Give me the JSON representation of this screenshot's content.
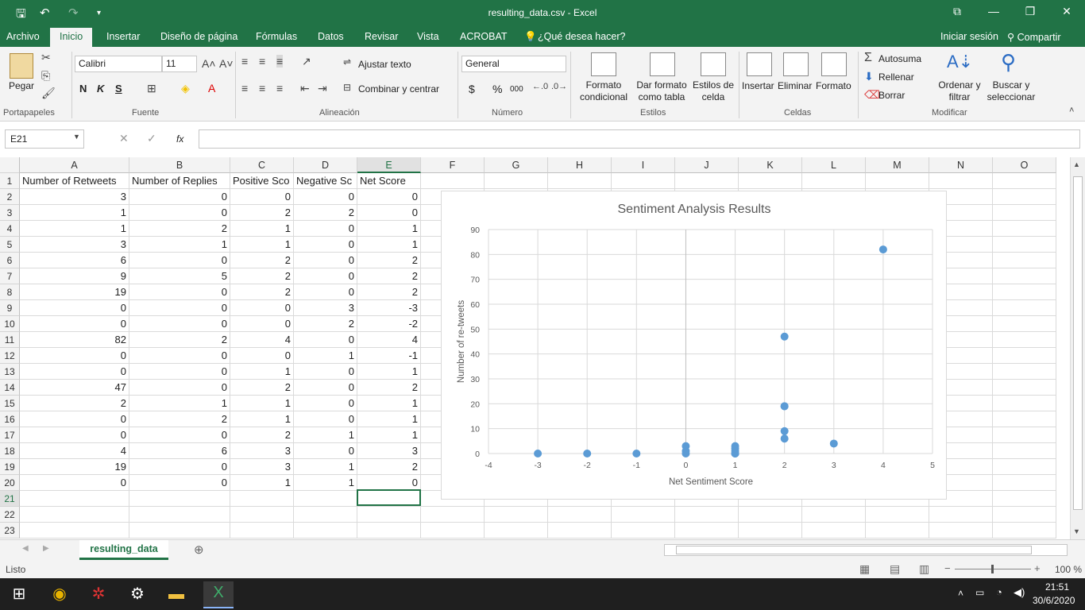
{
  "window": {
    "title": "resulting_data.csv - Excel"
  },
  "tabs": [
    "Archivo",
    "Inicio",
    "Insertar",
    "Diseño de página",
    "Fórmulas",
    "Datos",
    "Revisar",
    "Vista",
    "ACROBAT"
  ],
  "tell_me": "¿Qué desea hacer?",
  "signin": "Iniciar sesión",
  "share": "Compartir",
  "ribbon": {
    "paste": "Pegar",
    "font_name": "Calibri",
    "font_size": "11",
    "bold": "N",
    "italic": "K",
    "underline": "S",
    "wrap_text": "Ajustar texto",
    "merge_center": "Combinar y centrar",
    "number_format": "General",
    "currency": "$",
    "percent": "%",
    "thousands": "000",
    "cond_format_1": "Formato",
    "cond_format_2": "condicional",
    "table_format_1": "Dar formato",
    "table_format_2": "como tabla",
    "cell_styles_1": "Estilos de",
    "cell_styles_2": "celda",
    "insert": "Insertar",
    "delete": "Eliminar",
    "format": "Formato",
    "autosum": "Autosuma",
    "fill": "Rellenar",
    "clear": "Borrar",
    "sort_filter_1": "Ordenar y",
    "sort_filter_2": "filtrar",
    "find_select_1": "Buscar y",
    "find_select_2": "seleccionar",
    "groups": [
      "Portapapeles",
      "Fuente",
      "Alineación",
      "Número",
      "Estilos",
      "Celdas",
      "Modificar"
    ]
  },
  "formula_bar": {
    "name_box": "E21",
    "fx": "fx",
    "content": ""
  },
  "grid": {
    "columns": [
      "A",
      "B",
      "C",
      "D",
      "E",
      "F",
      "G",
      "H",
      "I",
      "J",
      "K",
      "L",
      "M",
      "N",
      "O"
    ],
    "row_numbers": [
      "1",
      "2",
      "3",
      "4",
      "5",
      "6",
      "7",
      "8",
      "9",
      "10",
      "11",
      "12",
      "13",
      "14",
      "15",
      "16",
      "17",
      "18",
      "19",
      "20",
      "21",
      "22",
      "23"
    ],
    "headers": [
      "Number of Retweets",
      "Number of Replies",
      "Positive Sco",
      "Negative Sc",
      "Net Score"
    ],
    "rows": [
      [
        "3",
        "0",
        "0",
        "0",
        "0"
      ],
      [
        "1",
        "0",
        "2",
        "2",
        "0"
      ],
      [
        "1",
        "2",
        "1",
        "0",
        "1"
      ],
      [
        "3",
        "1",
        "1",
        "0",
        "1"
      ],
      [
        "6",
        "0",
        "2",
        "0",
        "2"
      ],
      [
        "9",
        "5",
        "2",
        "0",
        "2"
      ],
      [
        "19",
        "0",
        "2",
        "0",
        "2"
      ],
      [
        "0",
        "0",
        "0",
        "3",
        "-3"
      ],
      [
        "0",
        "0",
        "0",
        "2",
        "-2"
      ],
      [
        "82",
        "2",
        "4",
        "0",
        "4"
      ],
      [
        "0",
        "0",
        "0",
        "1",
        "-1"
      ],
      [
        "0",
        "0",
        "1",
        "0",
        "1"
      ],
      [
        "47",
        "0",
        "2",
        "0",
        "2"
      ],
      [
        "2",
        "1",
        "1",
        "0",
        "1"
      ],
      [
        "0",
        "2",
        "1",
        "0",
        "1"
      ],
      [
        "0",
        "0",
        "2",
        "1",
        "1"
      ],
      [
        "4",
        "6",
        "3",
        "0",
        "3"
      ],
      [
        "19",
        "0",
        "3",
        "1",
        "2"
      ],
      [
        "0",
        "0",
        "1",
        "1",
        "0"
      ]
    ]
  },
  "chart_data": {
    "type": "scatter",
    "title": "Sentiment Analysis Results",
    "xlabel": "Net Sentiment Score",
    "ylabel": "Number of re-tweets",
    "xlim": [
      -4,
      5
    ],
    "ylim": [
      0,
      90
    ],
    "x_ticks": [
      "-4",
      "-3",
      "-2",
      "-1",
      "0",
      "1",
      "2",
      "3",
      "4",
      "5"
    ],
    "y_ticks": [
      "0",
      "10",
      "20",
      "30",
      "40",
      "50",
      "60",
      "70",
      "80",
      "90"
    ],
    "grid": true,
    "legend": "none",
    "color": "#5b9bd5",
    "points": [
      [
        0,
        3
      ],
      [
        0,
        1
      ],
      [
        1,
        1
      ],
      [
        1,
        3
      ],
      [
        2,
        6
      ],
      [
        2,
        9
      ],
      [
        2,
        19
      ],
      [
        -3,
        0
      ],
      [
        -2,
        0
      ],
      [
        4,
        82
      ],
      [
        -1,
        0
      ],
      [
        1,
        0
      ],
      [
        2,
        47
      ],
      [
        1,
        2
      ],
      [
        1,
        0
      ],
      [
        1,
        0
      ],
      [
        3,
        4
      ],
      [
        2,
        19
      ],
      [
        0,
        0
      ]
    ]
  },
  "sheet": {
    "tab_name": "resulting_data"
  },
  "status": {
    "ready": "Listo",
    "zoom": "100 %"
  },
  "taskbar": {
    "time": "21:51",
    "date": "30/6/2020"
  },
  "colors": {
    "accent": "#217346",
    "marker": "#5b9bd5"
  }
}
